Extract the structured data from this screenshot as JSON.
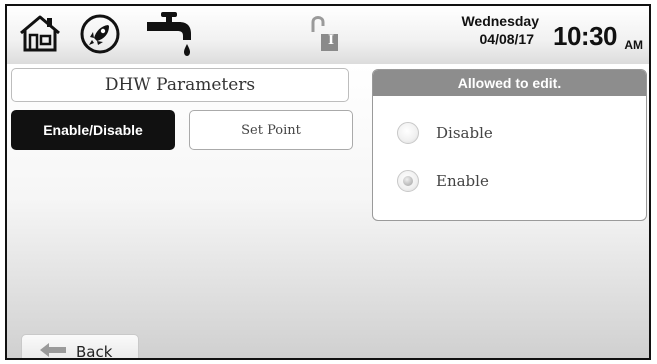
{
  "header": {
    "icons": [
      "home-icon",
      "rocket-icon",
      "faucet-icon",
      "unlock-icon"
    ],
    "lock_badge": "I",
    "day": "Wednesday",
    "date": "04/08/17",
    "time": "10:30",
    "ampm": "AM"
  },
  "page": {
    "title": "DHW Parameters"
  },
  "tabs": [
    {
      "label": "Enable/Disable",
      "active": true
    },
    {
      "label": "Set Point",
      "active": false
    }
  ],
  "panel": {
    "header": "Allowed to edit.",
    "options": [
      {
        "label": "Disable",
        "selected": false
      },
      {
        "label": "Enable",
        "selected": true
      }
    ]
  },
  "footer": {
    "back_label": "Back",
    "back_icon": "back-arrow-icon"
  }
}
